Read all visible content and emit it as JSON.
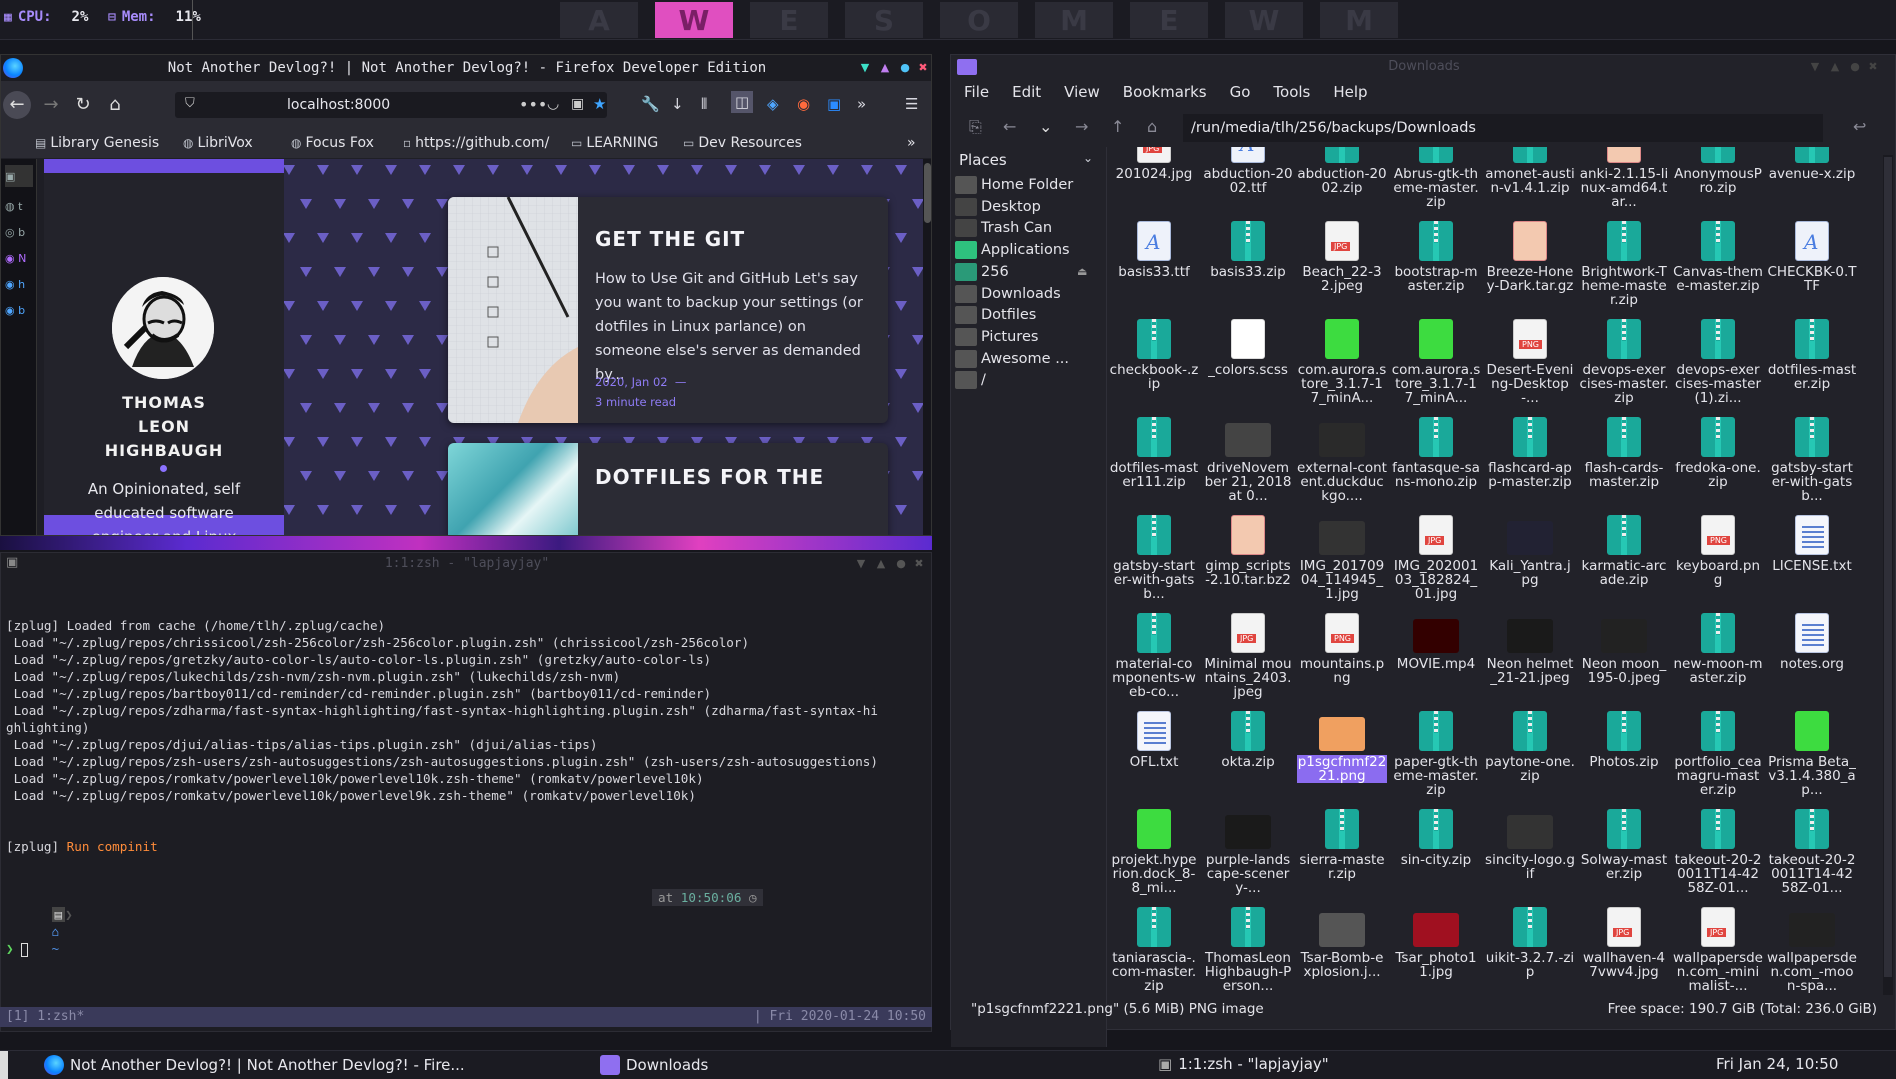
{
  "topbar": {
    "cpu_label": "CPU:",
    "cpu_value": "2%",
    "mem_label": "Mem:",
    "mem_value": "11%",
    "workspaces": [
      "A",
      "W",
      "E",
      "S",
      "O",
      "M",
      "E",
      "W",
      "M"
    ],
    "active_workspace_index": 1,
    "accent": "#e04fc0"
  },
  "firefox": {
    "title": "Not Another Devlog?! | Not Another Devlog?! - Firefox Developer Edition",
    "url": "localhost:8000",
    "bookmarks": [
      "Library Genesis",
      "LibriVox",
      "Focus Fox",
      "https://github.com/",
      "LEARNING",
      "Dev Resources"
    ],
    "profile": {
      "name_lines": [
        "THOMAS",
        "LEON",
        "HIGHBAUGH"
      ],
      "bio": "An Opinionated, self educated software engineer and Linux fanatic, with a"
    },
    "posts": [
      {
        "title": "GET THE GIT",
        "description": "How to Use Git and GitHub Let's say you want to backup your settings (or dotfiles in Linux parlance) on someone else's server as demanded by...",
        "date": "2020, Jan 02",
        "read_time": "3 minute read"
      },
      {
        "title": "DOTFILES FOR THE"
      }
    ]
  },
  "terminal": {
    "title": "1:1:zsh - \"lapjayjay\"",
    "lines": [
      "[zplug] Loaded from cache (/home/tlh/.zplug/cache)",
      " Load \"~/.zplug/repos/chrissicool/zsh-256color/zsh-256color.plugin.zsh\" (chrissicool/zsh-256color)",
      " Load \"~/.zplug/repos/gretzky/auto-color-ls/auto-color-ls.plugin.zsh\" (gretzky/auto-color-ls)",
      " Load \"~/.zplug/repos/lukechilds/zsh-nvm/zsh-nvm.plugin.zsh\" (lukechilds/zsh-nvm)",
      " Load \"~/.zplug/repos/bartboy011/cd-reminder/cd-reminder.plugin.zsh\" (bartboy011/cd-reminder)",
      " Load \"~/.zplug/repos/zdharma/fast-syntax-highlighting/fast-syntax-highlighting.plugin.zsh\" (zdharma/fast-syntax-hi",
      "ghlighting)",
      " Load \"~/.zplug/repos/djui/alias-tips/alias-tips.plugin.zsh\" (djui/alias-tips)",
      " Load \"~/.zplug/repos/zsh-users/zsh-autosuggestions/zsh-autosuggestions.plugin.zsh\" (zsh-users/zsh-autosuggestions)",
      " Load \"~/.zplug/repos/romkatv/powerlevel10k/powerlevel10k.zsh-theme\" (romkatv/powerlevel10k)",
      " Load \"~/.zplug/repos/romkatv/powerlevel10k/powerlevel9k.zsh-theme\" (romkatv/powerlevel10k)"
    ],
    "compinit_prefix": "[zplug] ",
    "compinit_text": "Run compinit",
    "prompt_home": "~",
    "time_prefix": "at ",
    "time": "10:50:06",
    "cursor_prompt": "❯",
    "tmux_left": "[1] 1:zsh*",
    "tmux_right": "| Fri 2020-01-24 10:50"
  },
  "filemanager": {
    "title": "Downloads",
    "menu": [
      "File",
      "Edit",
      "View",
      "Bookmarks",
      "Go",
      "Tools",
      "Help"
    ],
    "path": "/run/media/tlh/256/backups/Downloads",
    "places_header": "Places",
    "places": [
      "Home Folder",
      "Desktop",
      "Trash Can",
      "Applications",
      "256",
      "Downloads",
      "Dotfiles",
      "Pictures",
      "Awesome ...",
      "/"
    ],
    "files": [
      {
        "name": "201024.jpg",
        "type": "img"
      },
      {
        "name": "abduction-2002.ttf",
        "type": "doc"
      },
      {
        "name": "abduction-2002.zip",
        "type": "zip"
      },
      {
        "name": "Abrus-gtk-theme-master.zip",
        "type": "zip"
      },
      {
        "name": "amonet-austin-v1.4.1.zip",
        "type": "zip"
      },
      {
        "name": "anki-2.1.15-linux-amd64.tar...",
        "type": "tgz"
      },
      {
        "name": "AnonymousPro.zip",
        "type": "zip"
      },
      {
        "name": "avenue-x.zip",
        "type": "zip"
      },
      {
        "name": "basis33.ttf",
        "type": "doc"
      },
      {
        "name": "basis33.zip",
        "type": "zip"
      },
      {
        "name": "Beach_22-32.jpeg",
        "type": "img"
      },
      {
        "name": "bootstrap-master.zip",
        "type": "zip"
      },
      {
        "name": "Breeze-Honey-Dark.tar.gz",
        "type": "tgz"
      },
      {
        "name": "Brightwork-Theme-master.zip",
        "type": "zip"
      },
      {
        "name": "Canvas-theme-master.zip",
        "type": "zip"
      },
      {
        "name": "CHECKBK-0.TTF",
        "type": "doc"
      },
      {
        "name": "checkbook-.zip",
        "type": "zip"
      },
      {
        "name": "_colors.scss",
        "type": "scss"
      },
      {
        "name": "com.aurora.store_3.1.7-17_minA...",
        "type": "apk"
      },
      {
        "name": "com.aurora.store_3.1.7-17_minA...",
        "type": "apk"
      },
      {
        "name": "Desert-Evening-Desktop-...",
        "type": "png"
      },
      {
        "name": "devops-exercises-master.zip",
        "type": "zip"
      },
      {
        "name": "devops-exercises-master(1).zi...",
        "type": "zip"
      },
      {
        "name": "dotfiles-master.zip",
        "type": "zip"
      },
      {
        "name": "dotfiles-master111.zip",
        "type": "zip"
      },
      {
        "name": "driveNovember 21, 2018 at 0...",
        "type": "photo"
      },
      {
        "name": "external-content.duckduckgo....",
        "type": "photo"
      },
      {
        "name": "fantasque-sans-mono.zip",
        "type": "zip"
      },
      {
        "name": "flashcard-app-master.zip",
        "type": "zip"
      },
      {
        "name": "flash-cards-master.zip",
        "type": "zip"
      },
      {
        "name": "fredoka-one.zip",
        "type": "zip"
      },
      {
        "name": "gatsby-starter-with-gatsb...",
        "type": "zip"
      },
      {
        "name": "gatsby-starter-with-gatsb...",
        "type": "zip"
      },
      {
        "name": "gimp_scripts-2.10.tar.bz2",
        "type": "tgz"
      },
      {
        "name": "IMG_20170904_114945_1.jpg",
        "type": "photo"
      },
      {
        "name": "IMG_20200103_182824_01.jpg",
        "type": "img"
      },
      {
        "name": "Kali_Yantra.jpg",
        "type": "photo"
      },
      {
        "name": "karmatic-arcade.zip",
        "type": "zip"
      },
      {
        "name": "keyboard.png",
        "type": "png"
      },
      {
        "name": "LICENSE.txt",
        "type": "txt"
      },
      {
        "name": "material-components-web-co...",
        "type": "zip"
      },
      {
        "name": "Minimal mountains_2403.jpeg",
        "type": "img"
      },
      {
        "name": "mountains.png",
        "type": "png"
      },
      {
        "name": "MOVIE.mp4",
        "type": "photo"
      },
      {
        "name": "Neon helmet_21-21.jpeg",
        "type": "photo"
      },
      {
        "name": "Neon moon_195-0.jpeg",
        "type": "photo"
      },
      {
        "name": "new-moon-master.zip",
        "type": "zip"
      },
      {
        "name": "notes.org",
        "type": "txt"
      },
      {
        "name": "OFL.txt",
        "type": "txt"
      },
      {
        "name": "okta.zip",
        "type": "zip"
      },
      {
        "name": "p1sgcfnmf2221.png",
        "type": "photo",
        "selected": true
      },
      {
        "name": "paper-gtk-theme-master.zip",
        "type": "zip"
      },
      {
        "name": "paytone-one.zip",
        "type": "zip"
      },
      {
        "name": "Photos.zip",
        "type": "zip"
      },
      {
        "name": "portfolio_ceamagru-master.zip",
        "type": "zip"
      },
      {
        "name": "Prisma Beta_v3.1.4.380_ap...",
        "type": "apk"
      },
      {
        "name": "projekt.hyperion.dock_8-8_mi...",
        "type": "apk"
      },
      {
        "name": "purple-landscape-scenery-...",
        "type": "photo"
      },
      {
        "name": "sierra-master.zip",
        "type": "zip"
      },
      {
        "name": "sin-city.zip",
        "type": "zip"
      },
      {
        "name": "sincity-logo.gif",
        "type": "photo"
      },
      {
        "name": "Solway-master.zip",
        "type": "zip"
      },
      {
        "name": "takeout-20-20011T14-4258Z-01...",
        "type": "zip"
      },
      {
        "name": "takeout-20-20011T14-4258Z-01...",
        "type": "zip"
      },
      {
        "name": "taniarascia-.com-master.zip",
        "type": "zip"
      },
      {
        "name": "ThomasLeonHighbaugh-Person...",
        "type": "zip"
      },
      {
        "name": "Tsar-Bomb-explosion.j...",
        "type": "photo"
      },
      {
        "name": "Tsar_photo11.jpg",
        "type": "photo"
      },
      {
        "name": "uikit-3.2.7.-zip",
        "type": "zip"
      },
      {
        "name": "wallhaven-47vwv4.jpg",
        "type": "img"
      },
      {
        "name": "wallpapersden.com_-minimalist-...",
        "type": "img"
      },
      {
        "name": "wallpapersden.com_-moon-spa...",
        "type": "photo"
      }
    ],
    "status_left": "\"p1sgcfnmf2221.png\" (5.6 MiB) PNG image",
    "status_right": "Free space: 190.7 GiB (Total: 236.0 GiB)"
  },
  "taskbar": {
    "task1": "Not Another Devlog?! | Not Another Devlog?! - Fire...",
    "task2": "Downloads",
    "task3": "1:1:zsh - \"lapjayjay\"",
    "clock": "Fri Jan 24, 10:50"
  }
}
